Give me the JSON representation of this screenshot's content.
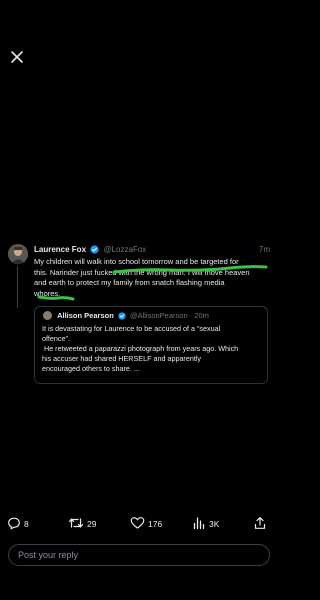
{
  "tweet": {
    "author_name": "Laurence Fox",
    "author_handle": "@LozzaFox",
    "time": "7m",
    "text_lines": [
      "My children will walk into school tomorrow and be targeted for",
      "this. Narinder just fucked with the wrong man. I will move heaven",
      "and earth to protect my family from snatch flashing media",
      "whores."
    ]
  },
  "quote": {
    "author_name": "Allison Pearson",
    "author_handle": "@AllisonPearson",
    "time": "· 20m",
    "text_lines": [
      "It is devastating for Laurence to be accused of a “sexual",
      "offence”.",
      " He retweeted a paparazzi photograph from years ago. Which",
      "his accuser had shared HERSELF and apparently",
      "encouraged others to share. ..."
    ]
  },
  "actions": {
    "replies": "8",
    "retweets": "29",
    "likes": "176",
    "views": "3K"
  },
  "reply_bar": {
    "placeholder": "Post your reply"
  },
  "colors": {
    "background": "#000000",
    "verified": "#1d9bf0",
    "annotation": "#3fbf4a",
    "muted": "#71767b"
  }
}
